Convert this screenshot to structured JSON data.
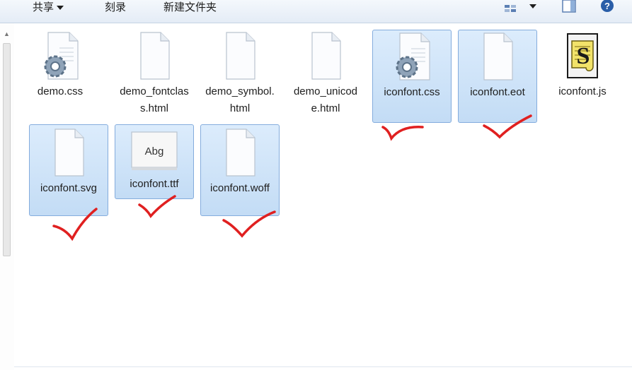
{
  "toolbar": {
    "share_label": "共享",
    "burn_label": "刻录",
    "new_folder_label": "新建文件夹"
  },
  "files": [
    {
      "name": "demo.css",
      "type": "css"
    },
    {
      "name": "demo_fontclass.html",
      "type": "blank"
    },
    {
      "name": "demo_symbol.html",
      "type": "blank"
    },
    {
      "name": "demo_unicode.html",
      "type": "blank"
    },
    {
      "name": "iconfont.css",
      "type": "css"
    },
    {
      "name": "iconfont.eot",
      "type": "blank"
    },
    {
      "name": "iconfont.js",
      "type": "js"
    },
    {
      "name": "iconfont.svg",
      "type": "blank"
    },
    {
      "name": "iconfont.ttf",
      "type": "font"
    },
    {
      "name": "iconfont.woff",
      "type": "blank"
    }
  ],
  "font_preview_text": "Abg",
  "colors": {
    "selection_bg": "#cde4fa",
    "selection_border": "#84acdd",
    "check_mark": "#e02020",
    "toolbar_bg": "#e9f0f8"
  }
}
